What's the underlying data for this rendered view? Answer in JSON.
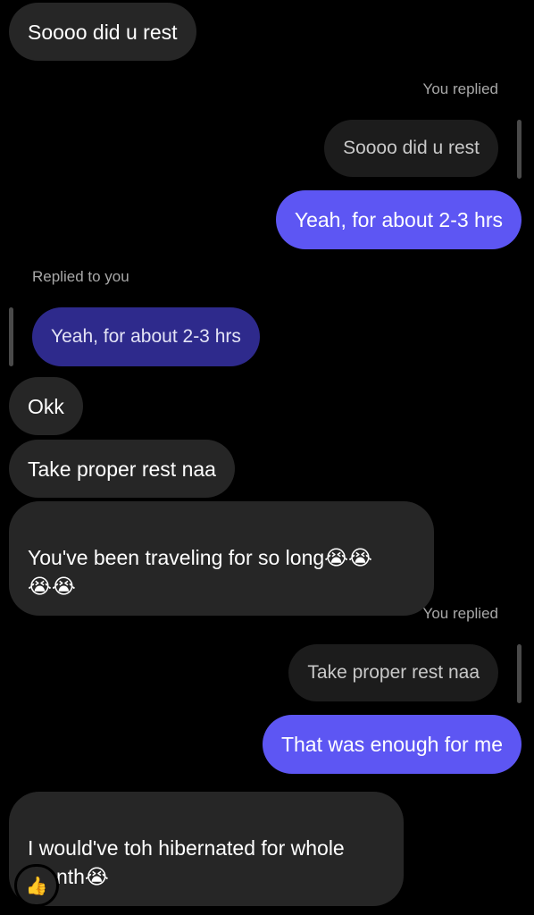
{
  "messages": {
    "m1": "Soooo did u rest",
    "reply1_label": "You replied",
    "reply1_quote": "Soooo did u rest",
    "m2": "Yeah, for about 2-3 hrs",
    "reply2_label": "Replied to you",
    "reply2_quote": "Yeah, for about 2-3 hrs",
    "m3": "Okk",
    "m4": "Take proper rest naa",
    "m5": "You've been traveling for so long😭😭\n😭😭",
    "reply3_label": "You replied",
    "reply3_quote": "Take proper rest naa",
    "m6": "That was enough for me",
    "m7": "I would've toh hibernated for whole\nmonth😭"
  },
  "reaction": {
    "emoji": "👍",
    "icon": "thumbs-up-icon"
  },
  "colors": {
    "background": "#000000",
    "incoming_bubble": "#262626",
    "outgoing_bubble": "#5d56f3",
    "quoted_incoming": "#2e2a8c",
    "quoted_outgoing": "#1c1c1c",
    "meta_text": "#a8a8a8"
  }
}
